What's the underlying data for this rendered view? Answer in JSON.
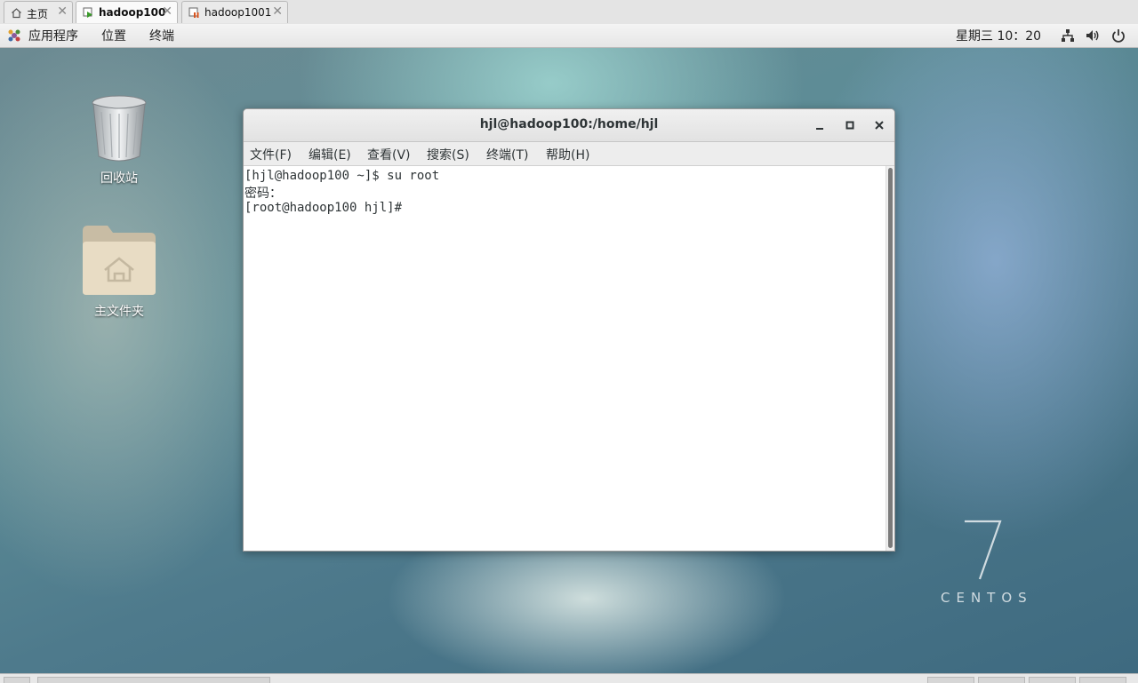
{
  "vm_tabs": [
    {
      "label": "主页",
      "icon": "home-icon",
      "active": false
    },
    {
      "label": "hadoop100",
      "icon": "vm-running-icon",
      "active": true
    },
    {
      "label": "hadoop1001",
      "icon": "vm-paused-icon",
      "active": false
    }
  ],
  "topbar": {
    "applications": "应用程序",
    "places": "位置",
    "terminal": "终端",
    "clock": "星期三 10：20",
    "icons": [
      "network-icon",
      "volume-icon",
      "power-icon"
    ]
  },
  "desktop": {
    "icons": [
      {
        "label": "回收站",
        "icon": "trash-icon"
      },
      {
        "label": "主文件夹",
        "icon": "home-folder-icon"
      }
    ],
    "watermark_number": "7",
    "watermark_text": "CENTOS"
  },
  "terminal_window": {
    "title": "hjl@hadoop100:/home/hjl",
    "menu": [
      "文件(F)",
      "编辑(E)",
      "查看(V)",
      "搜索(S)",
      "终端(T)",
      "帮助(H)"
    ],
    "lines": [
      "[hjl@hadoop100 ~]$ su root",
      "密码：",
      "[root@hadoop100 hjl]#"
    ]
  },
  "colors": {
    "desktop_base": "#4e7a8c",
    "terminal_background": "#ffffff",
    "terminal_text": "#2e3436"
  }
}
